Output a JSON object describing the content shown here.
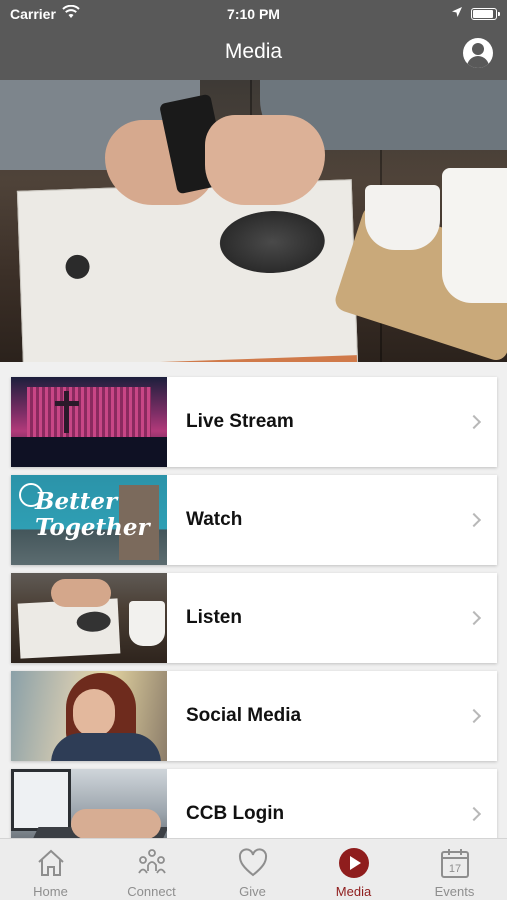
{
  "status_bar": {
    "carrier": "Carrier",
    "time": "7:10 PM",
    "icons": [
      "wifi-icon",
      "location-arrow-icon",
      "battery-icon"
    ]
  },
  "nav": {
    "title": "Media",
    "profile_icon": "user-profile-icon"
  },
  "hero": {
    "icon": "hero-photo-coffee-phone-magazine"
  },
  "media_items": [
    {
      "label": "Live Stream",
      "thumbnail": "stage-worship-thumbnail",
      "chevron": "chevron-right-icon"
    },
    {
      "label": "Watch",
      "thumbnail": "better-together-sign-thumbnail",
      "thumb_text_1": "Better",
      "thumb_text_2": "Together",
      "chevron": "chevron-right-icon"
    },
    {
      "label": "Listen",
      "thumbnail": "coffee-magazine-thumbnail",
      "chevron": "chevron-right-icon"
    },
    {
      "label": "Social Media",
      "thumbnail": "woman-with-phone-thumbnail",
      "chevron": "chevron-right-icon"
    },
    {
      "label": "CCB Login",
      "thumbnail": "laptop-typing-thumbnail",
      "chevron": "chevron-right-icon"
    }
  ],
  "tabs": [
    {
      "label": "Home",
      "icon": "house-icon",
      "active": false
    },
    {
      "label": "Connect",
      "icon": "people-icon",
      "active": false
    },
    {
      "label": "Give",
      "icon": "heart-icon",
      "active": false
    },
    {
      "label": "Media",
      "icon": "play-icon",
      "active": true
    },
    {
      "label": "Events",
      "icon": "calendar-icon",
      "active": false,
      "calendar_day": "17"
    }
  ],
  "colors": {
    "nav_background": "#595959",
    "tab_active": "#8f1d1d",
    "tab_inactive": "#8e8e8e",
    "list_background": "#f0f0f0"
  }
}
